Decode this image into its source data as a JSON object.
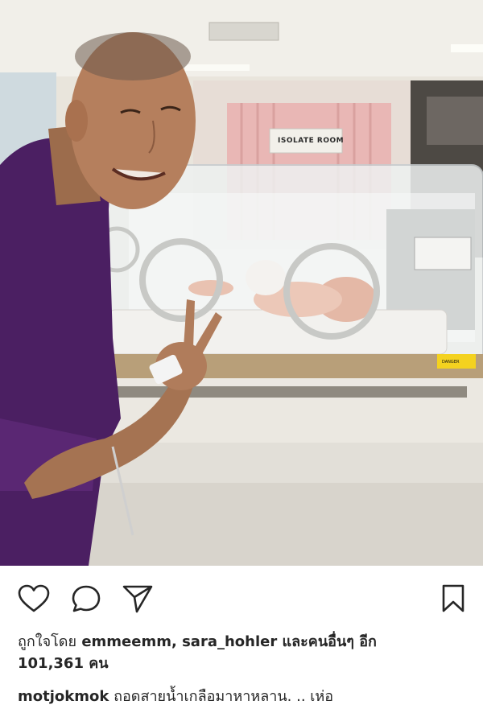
{
  "photo": {
    "room_sign": "ISOLATE ROOM",
    "sticker_text": "DANGER"
  },
  "actions": {
    "like_icon": "heart-icon",
    "comment_icon": "comment-bubble-icon",
    "share_icon": "paper-plane-icon",
    "save_icon": "bookmark-icon"
  },
  "likes": {
    "prefix": "ถูกใจโดย",
    "users": "emmeemm, sara_hohler",
    "connector": "และคนอื่นๆ อีก",
    "count": "101,361",
    "unit": "คน"
  },
  "caption": {
    "username": "motjokmok",
    "text": "ถอดสายน้ำเกลือมาหาหลาน. .. เห่อ"
  }
}
